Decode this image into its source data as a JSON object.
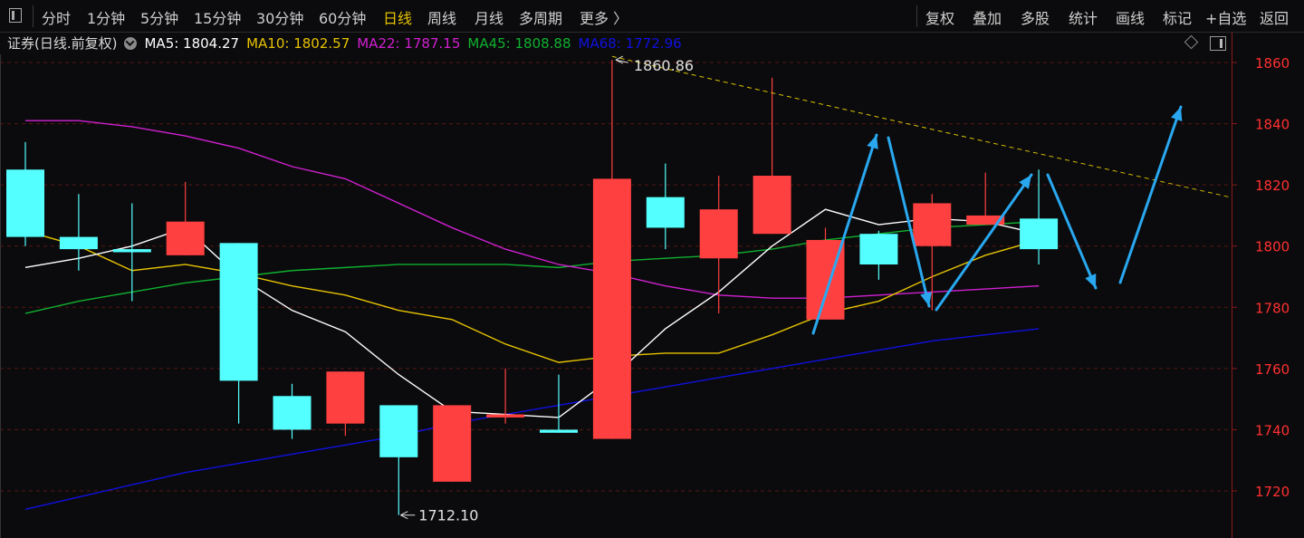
{
  "toolbar": {
    "left_items": [
      "分时",
      "1分钟",
      "5分钟",
      "15分钟",
      "30分钟",
      "60分钟",
      "日线",
      "周线",
      "月线",
      "多周期",
      "更多 〉"
    ],
    "active_index": 6,
    "right_items": [
      "复权",
      "叠加",
      "多股",
      "统计",
      "画线",
      "标记",
      "+自选",
      "返回"
    ]
  },
  "legend": {
    "name": "证券(日线.前复权)",
    "ma5": "MA5: 1804.27",
    "ma10": "MA10: 1802.57",
    "ma22": "MA22: 1787.15",
    "ma45": "MA45: 1808.88",
    "ma68": "MA68: 1772.96"
  },
  "colors": {
    "up": "#ff4040",
    "down": "#54ffff",
    "ma5": "#ffffff",
    "ma10": "#e6c200",
    "ma22": "#d020d0",
    "ma45": "#10b030",
    "ma68": "#1010e0",
    "arrow": "#29a8f0",
    "trendline": "#d8c000"
  },
  "chart_data": {
    "type": "candlestick",
    "ylim": [
      1710,
      1866
    ],
    "yticks": [
      1720,
      1740,
      1760,
      1780,
      1800,
      1820,
      1840,
      1860
    ],
    "candles": [
      {
        "open": 1825,
        "close": 1803,
        "high": 1834,
        "low": 1800
      },
      {
        "open": 1803,
        "close": 1799,
        "high": 1817,
        "low": 1792
      },
      {
        "open": 1799,
        "close": 1798,
        "high": 1814,
        "low": 1782
      },
      {
        "open": 1797,
        "close": 1808,
        "high": 1821,
        "low": 1797
      },
      {
        "open": 1801,
        "close": 1756,
        "high": 1801,
        "low": 1742
      },
      {
        "open": 1751,
        "close": 1740,
        "high": 1755,
        "low": 1737
      },
      {
        "open": 1742,
        "close": 1759,
        "high": 1759,
        "low": 1738
      },
      {
        "open": 1748,
        "close": 1731,
        "high": 1748,
        "low": 1712.1
      },
      {
        "open": 1723,
        "close": 1748,
        "high": 1748,
        "low": 1723
      },
      {
        "open": 1744,
        "close": 1745,
        "high": 1760,
        "low": 1742
      },
      {
        "open": 1740,
        "close": 1739,
        "high": 1758,
        "low": 1739
      },
      {
        "open": 1737,
        "close": 1822,
        "high": 1860.86,
        "low": 1737
      },
      {
        "open": 1816,
        "close": 1806,
        "high": 1827,
        "low": 1799
      },
      {
        "open": 1796,
        "close": 1812,
        "high": 1823,
        "low": 1778
      },
      {
        "open": 1804,
        "close": 1823,
        "high": 1855,
        "low": 1804
      },
      {
        "open": 1776,
        "close": 1802,
        "high": 1806,
        "low": 1776
      },
      {
        "open": 1804,
        "close": 1794,
        "high": 1805,
        "low": 1789
      },
      {
        "open": 1800,
        "close": 1814,
        "high": 1817,
        "low": 1779
      },
      {
        "open": 1807,
        "close": 1810,
        "high": 1824,
        "low": 1807
      },
      {
        "open": 1809,
        "close": 1799,
        "high": 1825,
        "low": 1794
      }
    ],
    "ma5": [
      1793,
      1796,
      1800,
      1806,
      1790,
      1779,
      1772,
      1758,
      1746,
      1745,
      1744,
      1757,
      1773,
      1785,
      1800,
      1812,
      1807,
      1809,
      1808,
      1804
    ],
    "ma10": [
      1805,
      1800,
      1792,
      1794,
      1791,
      1787,
      1784,
      1779,
      1776,
      1768,
      1762,
      1764,
      1765,
      1765,
      1771,
      1778,
      1782,
      1790,
      1797,
      1802
    ],
    "ma22": [
      1841,
      1841,
      1839,
      1836,
      1832,
      1826,
      1822,
      1814,
      1806,
      1799,
      1794,
      1791,
      1787,
      1784,
      1783,
      1783,
      1784,
      1785,
      1786,
      1787
    ],
    "ma45": [
      1778,
      1782,
      1785,
      1788,
      1790,
      1792,
      1793,
      1794,
      1794,
      1794,
      1793,
      1795,
      1796,
      1797,
      1799,
      1802,
      1804,
      1806,
      1807,
      1808
    ],
    "ma68": [
      1714,
      1718,
      1722,
      1726,
      1729,
      1732,
      1735,
      1738,
      1742,
      1745,
      1748,
      1751,
      1754,
      1757,
      1760,
      1763,
      1766,
      1769,
      1771,
      1773
    ],
    "annotations": {
      "high_label": "1860.86",
      "low_label": "1712.10"
    }
  }
}
